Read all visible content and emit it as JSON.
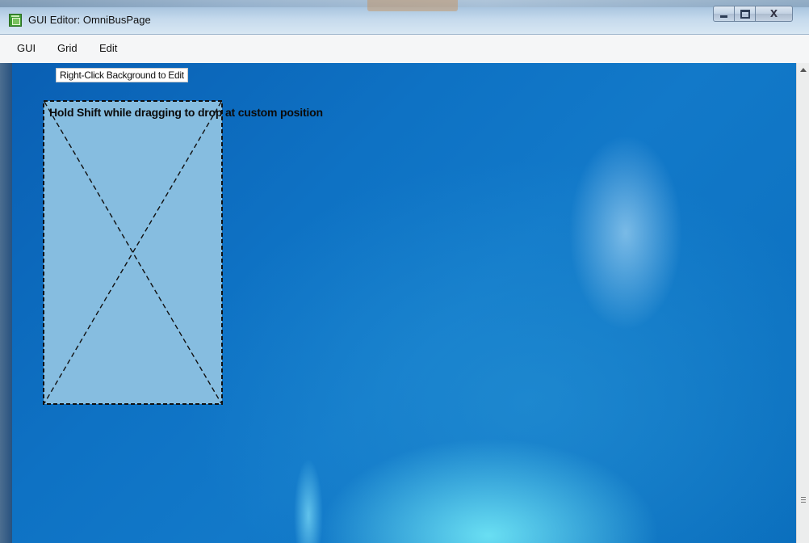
{
  "window": {
    "title": "GUI Editor: OmniBusPage"
  },
  "caption_buttons": {
    "minimize_icon": "minimize-icon",
    "maximize_icon": "maximize-icon",
    "close_glyph": "X"
  },
  "menu": {
    "items": [
      {
        "label": "GUI"
      },
      {
        "label": "Grid"
      },
      {
        "label": "Edit"
      }
    ]
  },
  "canvas": {
    "hint_label": "Right-Click Background to Edit",
    "shift_hint": "Hold Shift while dragging to drop at custom position",
    "placeholder_icon": "empty-placeholder-cross-icon",
    "colors": {
      "background": "#0e72c4",
      "placeholder_fill": "#86bde0",
      "placeholder_border": "#111111"
    }
  }
}
